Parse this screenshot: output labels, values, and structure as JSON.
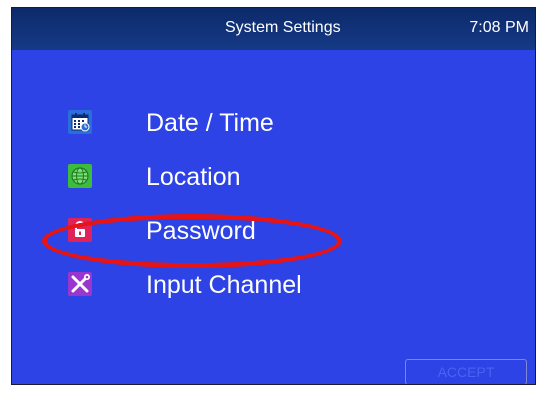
{
  "header": {
    "title": "System Settings",
    "time": "7:08 PM"
  },
  "menu": {
    "items": [
      {
        "label": "Date / Time",
        "icon": "calendar-clock-icon"
      },
      {
        "label": "Location",
        "icon": "globe-icon"
      },
      {
        "label": "Password",
        "icon": "lock-icon"
      },
      {
        "label": "Input Channel",
        "icon": "wrench-screwdriver-icon"
      }
    ]
  },
  "footer": {
    "accept_label": "ACCEPT"
  },
  "colors": {
    "screen_bg": "#2d43e6",
    "titlebar_bg": "#0c2a6a",
    "highlight": "#e61414"
  }
}
